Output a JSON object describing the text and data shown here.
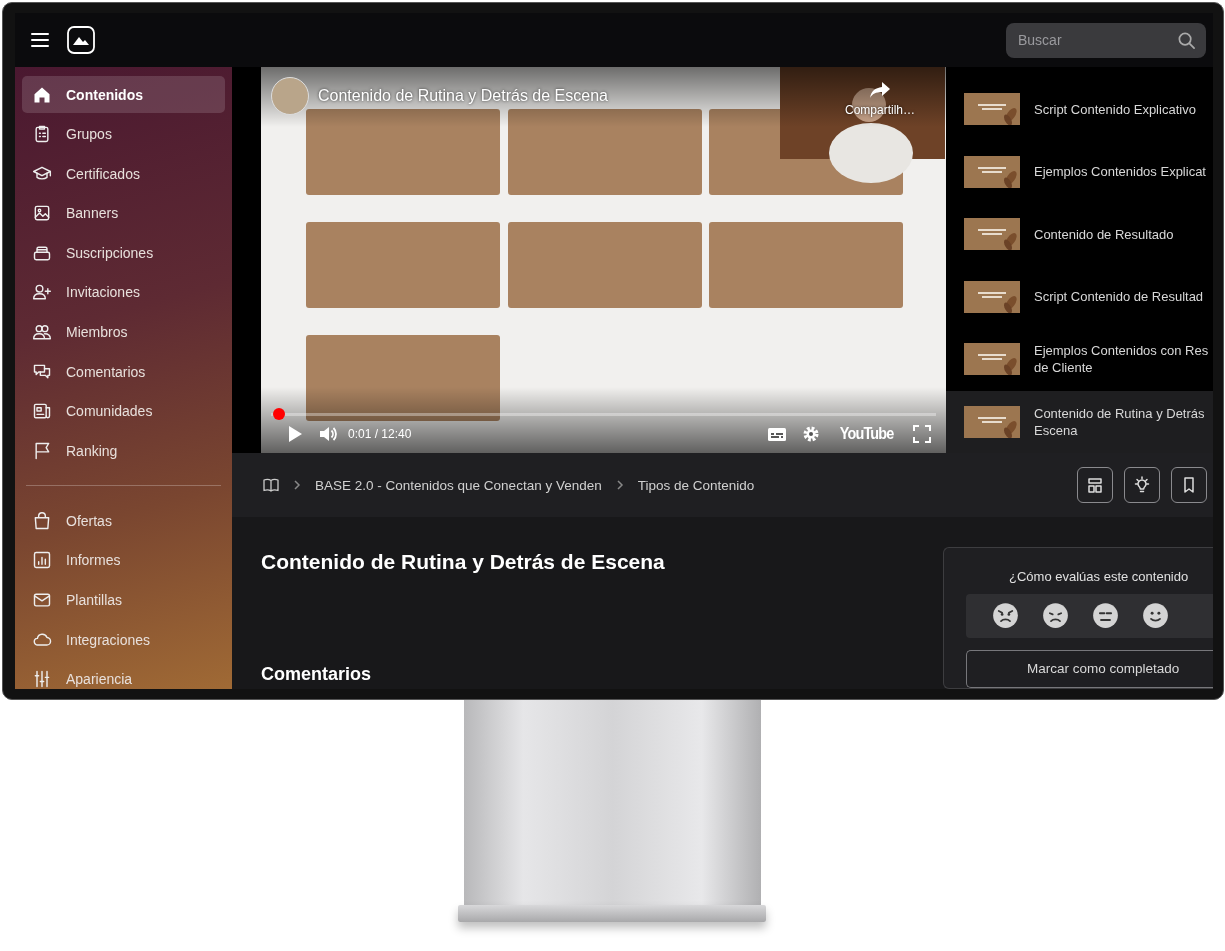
{
  "top_bar": {
    "search": {
      "placeholder": "Buscar"
    }
  },
  "sidebar": {
    "items": [
      {
        "label": "Contenidos",
        "selected": true
      },
      {
        "label": "Grupos",
        "selected": false
      },
      {
        "label": "Certificados",
        "selected": false
      },
      {
        "label": "Banners",
        "selected": false
      },
      {
        "label": "Suscripciones",
        "selected": false
      },
      {
        "label": "Invitaciones",
        "selected": false
      },
      {
        "label": "Miembros",
        "selected": false
      },
      {
        "label": "Comentarios",
        "selected": false
      },
      {
        "label": "Comunidades",
        "selected": false
      },
      {
        "label": "Ranking",
        "selected": false
      }
    ],
    "secondary_items": [
      {
        "label": "Ofertas",
        "selected": false
      },
      {
        "label": "Informes",
        "selected": false
      },
      {
        "label": "Plantillas",
        "selected": false
      },
      {
        "label": "Integraciones",
        "selected": false
      },
      {
        "label": "Apariencia",
        "selected": false
      }
    ]
  },
  "video": {
    "title": "Contenido de Rutina y Detrás de Escena",
    "share_label": "Compartilh…",
    "time": "0:01 / 12:40",
    "brand": "YouTube",
    "progress": {
      "level": 0.003
    }
  },
  "playlist": [
    {
      "title_lines": [
        "Script Contenido Explicativo"
      ],
      "selected": false
    },
    {
      "title_lines": [
        "Ejemplos Contenidos Explicat"
      ],
      "selected": false
    },
    {
      "title_lines": [
        "Contenido de Resultado"
      ],
      "selected": false
    },
    {
      "title_lines": [
        "Script Contenido de Resultad"
      ],
      "selected": false
    },
    {
      "title_lines": [
        "Ejemplos Contenidos con Res",
        "de Cliente"
      ],
      "selected": false
    },
    {
      "title_lines": [
        "Contenido de Rutina y Detrás",
        "Escena"
      ],
      "selected": true
    }
  ],
  "breadcrumb": [
    "BASE 2.0 - Contenidos que Conectan y Venden",
    "Tipos de Contenido"
  ],
  "lesson": {
    "title": "Contenido de Rutina y Detrás de Escena",
    "comments_heading": "Comentarios"
  },
  "rating": {
    "question": "¿Cómo evalúas este contenido",
    "complete_button": "Marcar como completado"
  }
}
